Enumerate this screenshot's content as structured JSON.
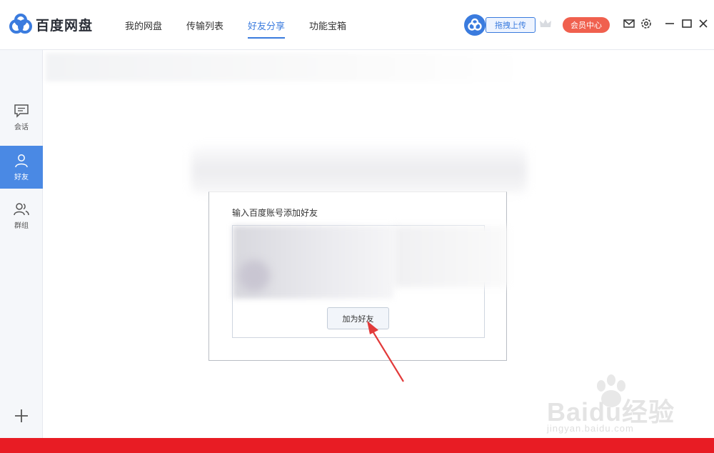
{
  "app": {
    "name": "百度网盘",
    "colors": {
      "accent": "#3a7bde",
      "vip": "#f0604e",
      "sidebar_active": "#4a89e4",
      "bottom_bar": "#e81c24"
    }
  },
  "nav": {
    "tabs": [
      {
        "label": "我的网盘",
        "active": false
      },
      {
        "label": "传输列表",
        "active": false
      },
      {
        "label": "好友分享",
        "active": true
      },
      {
        "label": "功能宝箱",
        "active": false
      }
    ]
  },
  "toolbar": {
    "upload_label": "拖拽上传",
    "vip_label": "会员中心",
    "icons": [
      "upload-cloud-icon",
      "crown-icon",
      "mail-icon",
      "settings-icon",
      "minimize-icon",
      "maximize-icon",
      "close-icon"
    ]
  },
  "sidebar": {
    "items": [
      {
        "label": "会话",
        "icon": "chat-icon",
        "active": false
      },
      {
        "label": "好友",
        "icon": "user-icon",
        "active": true
      },
      {
        "label": "群组",
        "icon": "group-icon",
        "active": false
      }
    ],
    "add_icon": "plus-icon"
  },
  "dialog": {
    "title": "输入百度账号添加好友",
    "button_label": "加为好友"
  },
  "watermark": {
    "line1": "Baidu经验",
    "line2": "jingyan.baidu.com"
  }
}
